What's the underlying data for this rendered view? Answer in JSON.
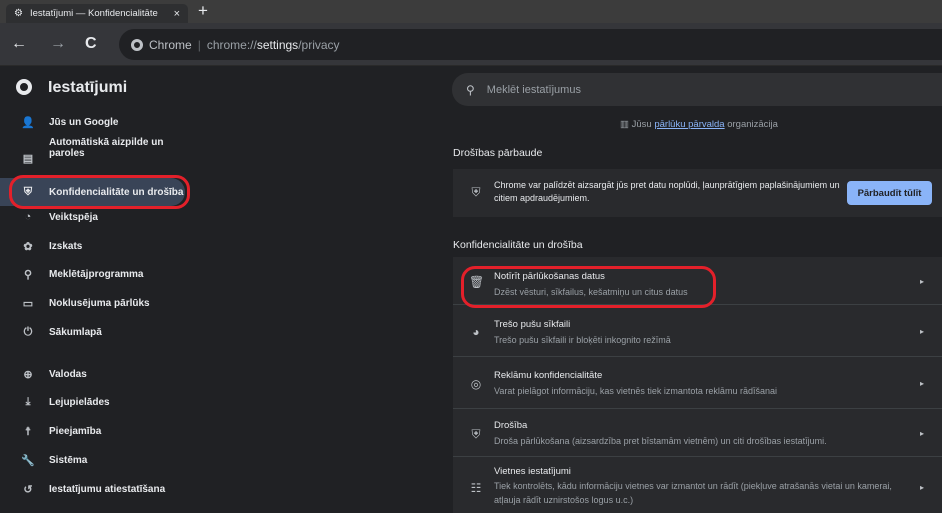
{
  "tab": {
    "title": "Iestatījumi — Konfidencialitāte",
    "close": "×",
    "new_tab": "+"
  },
  "toolbar": {
    "back": "←",
    "forward": "→",
    "reload": "C",
    "chip_label": "Chrome",
    "separator": "|",
    "url_base": "chrome://",
    "url_path": "settings",
    "url_tail": "/privacy"
  },
  "header": {
    "title": "Iestatījumi",
    "search_placeholder": "Meklēt iestatījumus"
  },
  "sidebar": {
    "items": [
      {
        "label": "Jūs un Google",
        "icon": "person-icon",
        "glyph": "👤"
      },
      {
        "label": "Automātiskā aizpilde un paroles",
        "icon": "clipboard-icon",
        "glyph": "▤"
      },
      {
        "label": "Konfidencialitāte un drošība",
        "icon": "shield-icon",
        "glyph": "⛨"
      },
      {
        "label": "Veiktspēja",
        "icon": "speedometer-icon",
        "glyph": "◔"
      },
      {
        "label": "Izskats",
        "icon": "palette-icon",
        "glyph": "✿"
      },
      {
        "label": "Meklētājprogramma",
        "icon": "search-icon",
        "glyph": "⚲"
      },
      {
        "label": "Noklusējuma pārlūks",
        "icon": "browser-icon",
        "glyph": "▭"
      },
      {
        "label": "Sākumlapā",
        "icon": "power-icon",
        "glyph": "⏻"
      },
      {
        "label": "Valodas",
        "icon": "globe-icon",
        "glyph": "⊕"
      },
      {
        "label": "Lejupielādes",
        "icon": "download-icon",
        "glyph": "⤓"
      },
      {
        "label": "Pieejamība",
        "icon": "accessibility-icon",
        "glyph": "☨"
      },
      {
        "label": "Sistēma",
        "icon": "wrench-icon",
        "glyph": "🔧"
      },
      {
        "label": "Iestatījumu atiestatīšana",
        "icon": "reset-icon",
        "glyph": "↺"
      }
    ]
  },
  "managed": {
    "prefix": "Jūsu",
    "link": "pārlūku pārvalda",
    "suffix": "organizācija"
  },
  "safety": {
    "title": "Drošības pārbaude",
    "text": "Chrome var palīdzēt aizsargāt jūs pret datu noplūdi, ļaunprātīgiem paplašinājumiem un citiem apdraudējumiem.",
    "button": "Pārbaudīt tūlīt"
  },
  "privacy": {
    "title": "Konfidencialitāte un drošība",
    "rows": [
      {
        "title": "Notīrīt pārlūkošanas datus",
        "sub": "Dzēst vēsturi, sīkfailus, kešatmiņu un citus datus",
        "icon": "trash-icon",
        "glyph": "🗑"
      },
      {
        "title": "Trešo pušu sīkfaili",
        "sub": "Trešo pušu sīkfaili ir bloķēti inkognito režīmā",
        "icon": "cookie-icon",
        "glyph": "◕"
      },
      {
        "title": "Reklāmu konfidencialitāte",
        "sub": "Varat pielāgot informāciju, kas vietnēs tiek izmantota reklāmu rādīšanai",
        "icon": "ad-privacy-icon",
        "glyph": "◎"
      },
      {
        "title": "Drošība",
        "sub": "Droša pārlūkošana (aizsardzība pret bīstamām vietnēm) un citi drošības iestatījumi.",
        "icon": "shield-icon",
        "glyph": "⛨"
      },
      {
        "title": "Vietnes iestatījumi",
        "sub": "Tiek kontrolēts, kādu informāciju vietnes var izmantot un rādīt (piekļuve atrašanās vietai un kamerai, atļauja rādīt uznirstošos logus u.c.)",
        "icon": "sliders-icon",
        "glyph": "☷"
      }
    ]
  },
  "colors": {
    "background": "#202124",
    "accent": "#8ab4f8",
    "active_nav": "#394457",
    "annotation": "#e3202a"
  }
}
